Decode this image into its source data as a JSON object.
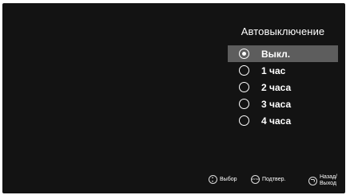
{
  "menu": {
    "title": "Автовыключение",
    "options": [
      {
        "label": "Выкл.",
        "selected": true
      },
      {
        "label": "1 час",
        "selected": false
      },
      {
        "label": "2 часа",
        "selected": false
      },
      {
        "label": "3 часа",
        "selected": false
      },
      {
        "label": "4 часа",
        "selected": false
      }
    ]
  },
  "footer": {
    "select_label": "Выбор",
    "enter_icon_text": "ENTER",
    "confirm_label": "Подтвер.",
    "back_label_line1": "Назад/",
    "back_label_line2": "Выход"
  },
  "colors": {
    "background": "#131313",
    "highlight": "#5d5d5d",
    "text": "#ffffff"
  }
}
